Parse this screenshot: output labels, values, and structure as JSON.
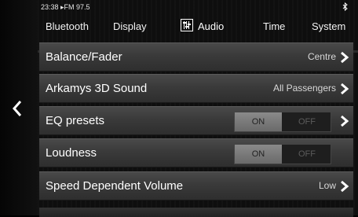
{
  "status": {
    "time_station": "23:38 ▸FM 97.5",
    "bluetooth_icon": "bluetooth-icon"
  },
  "tabs": [
    {
      "label": "Bluetooth",
      "active": false
    },
    {
      "label": "Display",
      "active": false
    },
    {
      "label": "Audio",
      "active": true,
      "icon": "equalizer-icon"
    },
    {
      "label": "Time",
      "active": false
    },
    {
      "label": "System",
      "active": false
    }
  ],
  "rows": [
    {
      "label": "Balance/Fader",
      "value": "Centre"
    },
    {
      "label": "Arkamys 3D Sound",
      "value": "All Passengers"
    },
    {
      "label": "EQ presets",
      "toggle": {
        "on": "ON",
        "off": "OFF",
        "state": "on"
      }
    },
    {
      "label": "Loudness",
      "toggle": {
        "on": "ON",
        "off": "OFF",
        "state": "on"
      }
    },
    {
      "label": "Speed Dependent Volume",
      "value": "Low"
    }
  ],
  "icons": {
    "back": "chevron-left-icon",
    "row_arrow": "chevron-right-icon"
  },
  "colors": {
    "background": "#0e0e0e",
    "row": "#3a3a3a",
    "toggle_on": "#7a7a7a",
    "text": "#ffffff"
  }
}
